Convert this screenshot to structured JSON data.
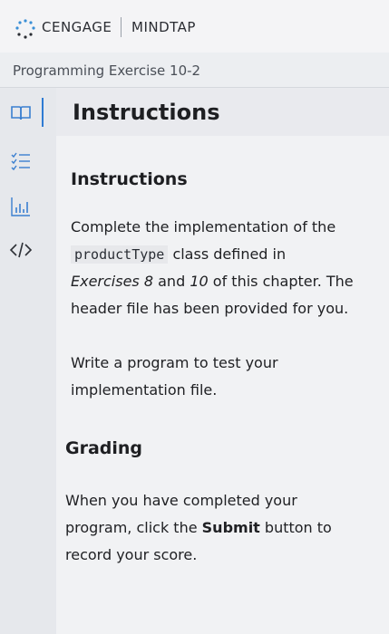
{
  "header": {
    "brand": "CENGAGE",
    "product": "MINDTAP"
  },
  "exercise": {
    "title": "Programming Exercise 10-2"
  },
  "tab": {
    "title": "Instructions"
  },
  "rail": {
    "items": [
      {
        "icon": "book-icon"
      },
      {
        "icon": "checklist-icon"
      },
      {
        "icon": "chart-icon"
      },
      {
        "icon": "code-icon"
      }
    ]
  },
  "instructions": {
    "heading": "Instructions",
    "p1_before": "Complete the implementation of the",
    "p1_code": "productType",
    "p1_after_code": "class defined in",
    "p1_em1": "Exercises 8",
    "p1_and": "and",
    "p1_em2": "10",
    "p1_end": "of this chapter. The header file has been provided for you.",
    "p2": "Write a program to test your implementation file."
  },
  "grading": {
    "heading": "Grading",
    "p_before": "When you have completed your program, click the",
    "p_strong": "Submit",
    "p_after": "button to record your score."
  }
}
